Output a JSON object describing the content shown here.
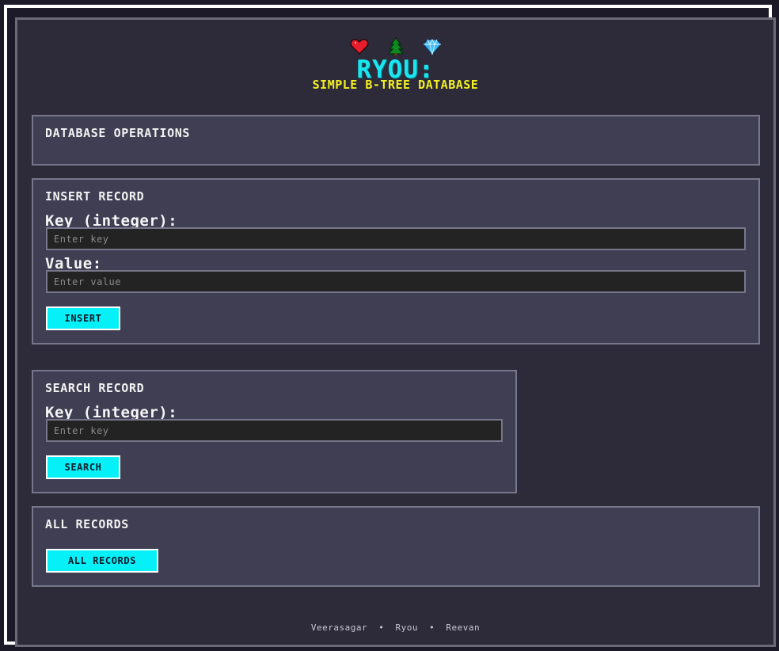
{
  "header": {
    "icons": [
      "heart-icon",
      "tree-icon",
      "diamond-icon"
    ],
    "title": "RYOU:",
    "subtitle": "SIMPLE B-TREE DATABASE"
  },
  "operations": {
    "title": "DATABASE OPERATIONS"
  },
  "insert": {
    "title": "INSERT RECORD",
    "key_label": "Key (integer):",
    "key_placeholder": "Enter key",
    "key_value": "",
    "value_label": "Value:",
    "value_placeholder": "Enter value",
    "value_value": "",
    "button_label": "INSERT"
  },
  "search": {
    "title": "SEARCH RECORD",
    "key_label": "Key (integer):",
    "key_placeholder": "Enter key",
    "key_value": "",
    "button_label": "SEARCH"
  },
  "all_records": {
    "title": "ALL RECORDS",
    "button_label": "ALL RECORDS"
  },
  "footer": {
    "items": [
      "Veerasagar",
      "Ryou",
      "Reevan"
    ],
    "separator": "•"
  },
  "colors": {
    "accent": "#06f0f8",
    "title": "#18e7f2",
    "subtitle": "#f4f023",
    "panel": "#403e53",
    "background": "#2d2b3a"
  }
}
